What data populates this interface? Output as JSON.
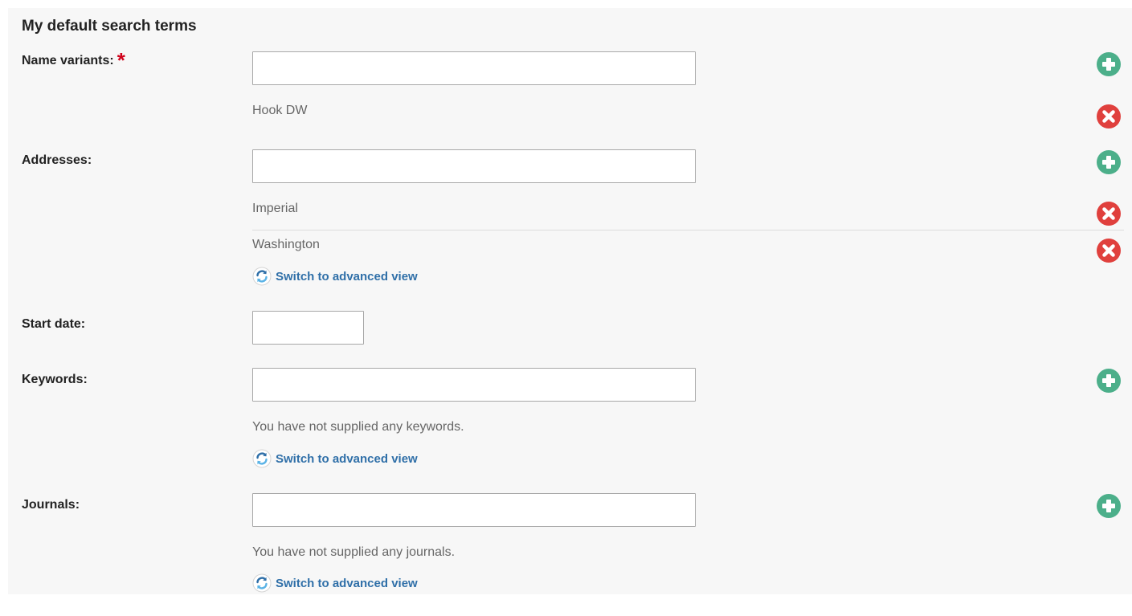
{
  "section": {
    "title": "My default search terms"
  },
  "name_variants": {
    "label": "Name variants:",
    "required_mark": "*",
    "input_value": "",
    "items": [
      "Hook DW"
    ]
  },
  "addresses": {
    "label": "Addresses:",
    "input_value": "",
    "items": [
      "Imperial",
      "Washington"
    ],
    "switch_link": "Switch to advanced view"
  },
  "start_date": {
    "label": "Start date:",
    "input_value": ""
  },
  "keywords": {
    "label": "Keywords:",
    "input_value": "",
    "empty_message": "You have not supplied any keywords.",
    "switch_link": "Switch to advanced view"
  },
  "journals": {
    "label": "Journals:",
    "input_value": "",
    "empty_message": "You have not supplied any journals.",
    "switch_link": "Switch to advanced view"
  },
  "icons": {
    "add": "plus-circle-icon",
    "remove": "x-circle-icon",
    "switch": "refresh-icon"
  },
  "colors": {
    "add": "#4caf8a",
    "remove": "#e0403d",
    "link": "#2f6fa8",
    "required": "#d0021b",
    "panel": "#f7f7f7"
  }
}
